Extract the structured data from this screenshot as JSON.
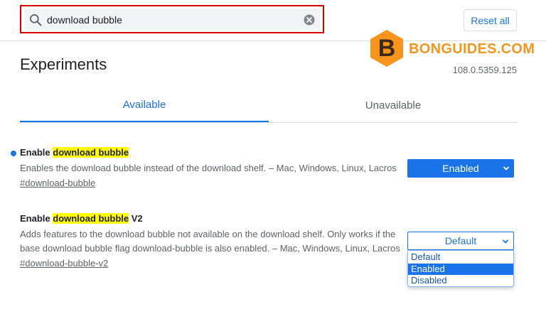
{
  "search": {
    "value": "download bubble"
  },
  "header": {
    "reset_label": "Reset all"
  },
  "watermark": {
    "brand_text": "BONGUIDES.COM",
    "logo_letter": "B"
  },
  "page": {
    "title": "Experiments",
    "version": "108.0.5359.125"
  },
  "tabs": [
    {
      "label": "Available"
    },
    {
      "label": "Unavailable"
    }
  ],
  "experiments": [
    {
      "title_prefix": "Enable ",
      "title_highlight": "download bubble",
      "title_suffix": "",
      "description": "Enables the download bubble instead of the download shelf. – Mac, Windows, Linux, Lacros",
      "link": "#download-bubble",
      "selected": "Enabled"
    },
    {
      "title_prefix": "Enable ",
      "title_highlight": "download bubble",
      "title_suffix": " V2",
      "description": "Adds features to the download bubble not available on the download shelf. Only works if the base download bubble flag download-bubble is also enabled. – Mac, Windows, Linux, Lacros",
      "link": "#download-bubble-v2",
      "selected": "Default"
    }
  ],
  "dropdown_options": [
    "Default",
    "Enabled",
    "Disabled"
  ],
  "colors": {
    "accent": "#1a73e8",
    "highlight": "#ffff00",
    "search_border": "#d50000",
    "brand": "#f7941d"
  }
}
